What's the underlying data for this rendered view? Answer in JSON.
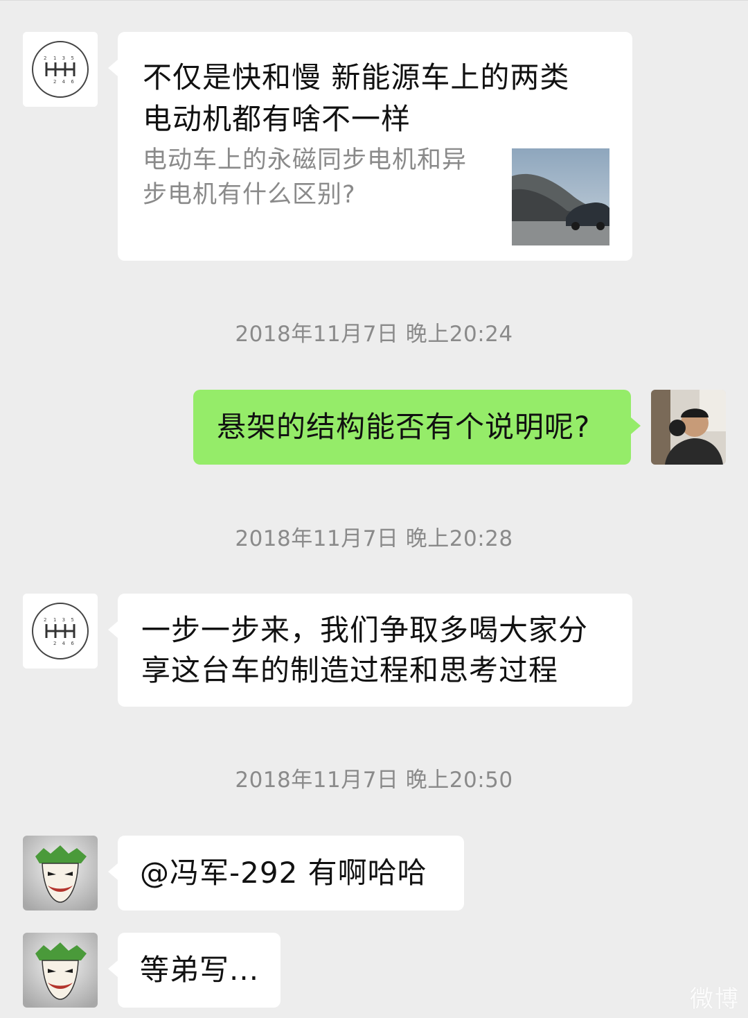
{
  "messages": {
    "link_card": {
      "title_line1": "不仅是快和慢 新能源车上的两类",
      "title_line2": "电动机都有啥不一样",
      "desc_line1": "电动车上的永磁同步电机和异",
      "desc_line2": "步电机有什么区别?"
    },
    "timestamps": [
      "2018年11月7日 晚上20:24",
      "2018年11月7日 晚上20:28",
      "2018年11月7日 晚上20:50"
    ],
    "question": "悬架的结构能否有个说明呢?",
    "reply_line1": "一步一步来，我们争取多喝大家分",
    "reply_line2": "享这台车的制造过程和思考过程",
    "mention_reply": "@冯军-292 有啊哈哈",
    "last_reply": "等弟写..."
  },
  "gear_logo": {
    "top_numbers": "1 3 5",
    "bottom_numbers": "2 4 6",
    "side_number": "2"
  },
  "watermark": "微博",
  "colors": {
    "chat_background": "#ededed",
    "sent_bubble": "#95ec69",
    "received_bubble": "#ffffff"
  },
  "icons": {
    "gear_avatar": "gear-shift-avatar-icon",
    "joker_avatar": "joker-avatar-icon",
    "user_avatar": "user-photo-avatar"
  }
}
